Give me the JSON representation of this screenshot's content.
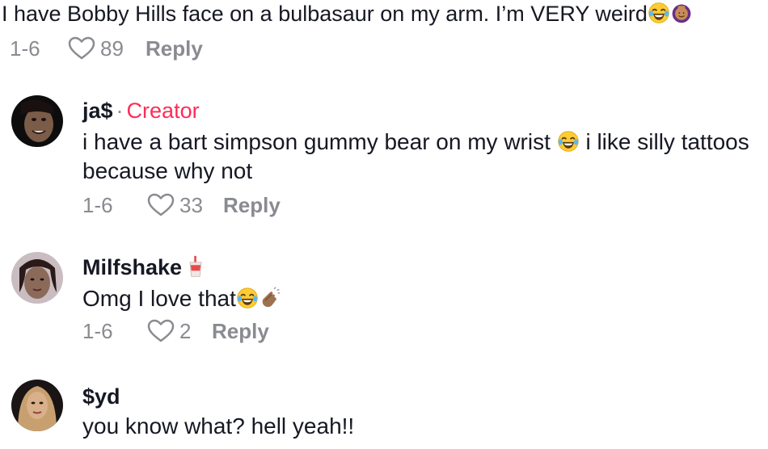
{
  "comments": [
    {
      "text": "I have Bobby Hills face on a bulbasaur on my arm. I’m VERY weird",
      "emojis": [
        "laughing-tears-emoji",
        "face-palm-emoji"
      ],
      "date": "1-6",
      "likes": "89",
      "reply_label": "Reply"
    },
    {
      "username": "ja$",
      "separator": "·",
      "badge": "Creator",
      "text_part1": "i have a bart simpson gummy bear on my wrist",
      "text_part2": "i like silly tattoos because why not",
      "emojis": [
        "laughing-tears-emoji"
      ],
      "date": "1-6",
      "likes": "33",
      "reply_label": "Reply"
    },
    {
      "username": "Milfshake",
      "name_emoji": "milkshake-cup-emoji",
      "text": "Omg I love that",
      "emojis": [
        "laughing-tears-emoji",
        "clapping-hands-emoji"
      ],
      "date": "1-6",
      "likes": "2",
      "reply_label": "Reply"
    },
    {
      "username": "$yd",
      "text": "you know what? hell yeah!!"
    }
  ],
  "colors": {
    "creator_badge": "#fe2c55",
    "meta_gray": "#8a8b91",
    "text": "#161823"
  }
}
